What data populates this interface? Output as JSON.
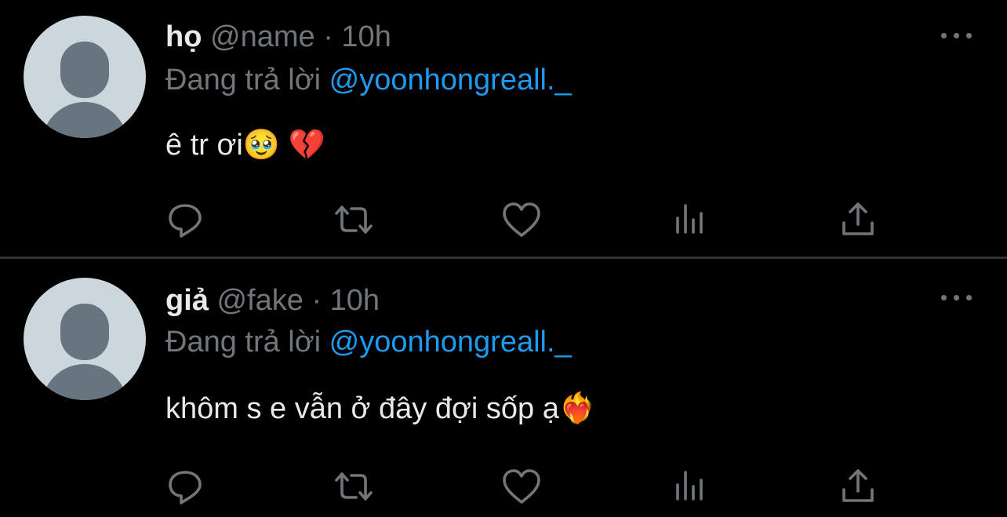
{
  "tweets": [
    {
      "name": "họ",
      "handle": "@name",
      "separator": "·",
      "time": "10h",
      "replying_prefix": "Đang trả lời",
      "replying_to": "@yoonhongreall._",
      "text": "ê tr ơi🥹 💔"
    },
    {
      "name": "giả",
      "handle": "@fake",
      "separator": "·",
      "time": "10h",
      "replying_prefix": "Đang trả lời",
      "replying_to": "@yoonhongreall._",
      "text": "khôm s e vẫn ở đây đợi sốp ạ❤️‍🔥"
    }
  ],
  "icons": [
    "reply-icon",
    "retweet-icon",
    "like-icon",
    "views-icon",
    "share-icon",
    "more-icon"
  ],
  "colors": {
    "background": "#000000",
    "text": "#e7e9ea",
    "muted": "#71767b",
    "link": "#1d9bf0",
    "divider": "#2f3336"
  }
}
